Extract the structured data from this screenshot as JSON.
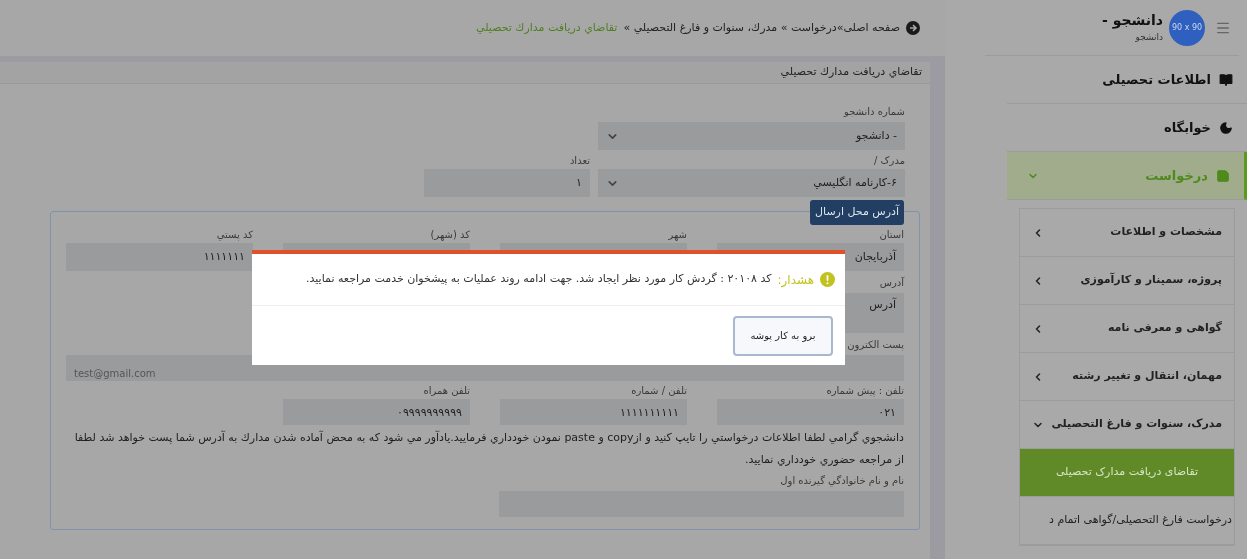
{
  "sidebar": {
    "user": {
      "avatar_label": "90 x 90",
      "name": "دانشجو -",
      "role": "دانشجو"
    },
    "items": [
      {
        "label": "اطلاعات تحصيلی",
        "selected": false
      },
      {
        "label": "خوابگاه",
        "selected": false
      },
      {
        "label": "درخواست",
        "selected": true,
        "expanded": true,
        "children": [
          {
            "label": "مشخصات و اطلاعات",
            "expanded": false
          },
          {
            "label": "پروژه، سمينار و کارآموزی",
            "expanded": false
          },
          {
            "label": "گواهی و معرفی نامه",
            "expanded": false
          },
          {
            "label": "مهمان، انتقال و تغيير رشته",
            "expanded": false
          },
          {
            "label": "مدرک، سنوات و فارغ التحصيلی",
            "expanded": true,
            "children": [
              {
                "label": "تقاضای دريافت مدارک تحصيلی",
                "selected": true
              },
              {
                "label": "درخواست فارغ التحصيلی/گواهی اتمام د",
                "selected": false
              }
            ]
          }
        ]
      }
    ]
  },
  "breadcrumb": {
    "trail": "صفحه اصلی»درخواست » مدرك، سنوات و فارغ التحصيلي »",
    "current": "تقاضاي دريافت مدارك تحصيلي"
  },
  "panel": {
    "title": "تقاضاي دريافت مدارك تحصيلي",
    "student": {
      "label": "شماره دانشجو",
      "value": "- دانشجو"
    },
    "document": {
      "label": "مدرک /",
      "value": "۶-کارنامه انگليسي"
    },
    "count": {
      "label": "تعداد",
      "value": "۱"
    },
    "address": {
      "legend": "آدرس محل ارسال",
      "row_fields": [
        {
          "label": "استان",
          "value": "آذربايجان"
        },
        {
          "label": "شهر"
        },
        {
          "label": "کد (شهر)"
        },
        {
          "label": "کد پستي",
          "value": "۱۱۱۱۱۱۱"
        }
      ],
      "address_label": "آدرس",
      "address_value": "آدرس",
      "email_label": "پست الکترون",
      "email_value": "test@gmail.com",
      "phone_fields": [
        {
          "label": "تلفن : پيش شماره",
          "value": "۰۲۱"
        },
        {
          "label": "تلفن / شماره",
          "value": "۱۱۱۱۱۱۱۱۱۱"
        },
        {
          "label": "تلفن همراه",
          "value": "۰۹۹۹۹۹۹۹۹۹۹"
        }
      ],
      "note": "دانشجوي گرامي لطفا اطلاعات درخواستي را تايپ كنيد و ازcopy و paste نمودن خودداري فرماييد.يادآور مي شود كه به محض آماده شدن مدارك به آدرس شما پست خواهد شد لطفا از مراجعه حضوري خودداري نماييد.",
      "recipient_label": "نام و نام خانوادگي گيرنده اول"
    }
  },
  "dialog": {
    "label": "هشدار:",
    "message": "کد ۲۰۱۰۸ : گردش کار مورد نظر ايجاد شد. جهت ادامه روند عمليات به پيشخوان خدمت مراجعه نماييد.",
    "button": "برو به کار پوشه"
  }
}
